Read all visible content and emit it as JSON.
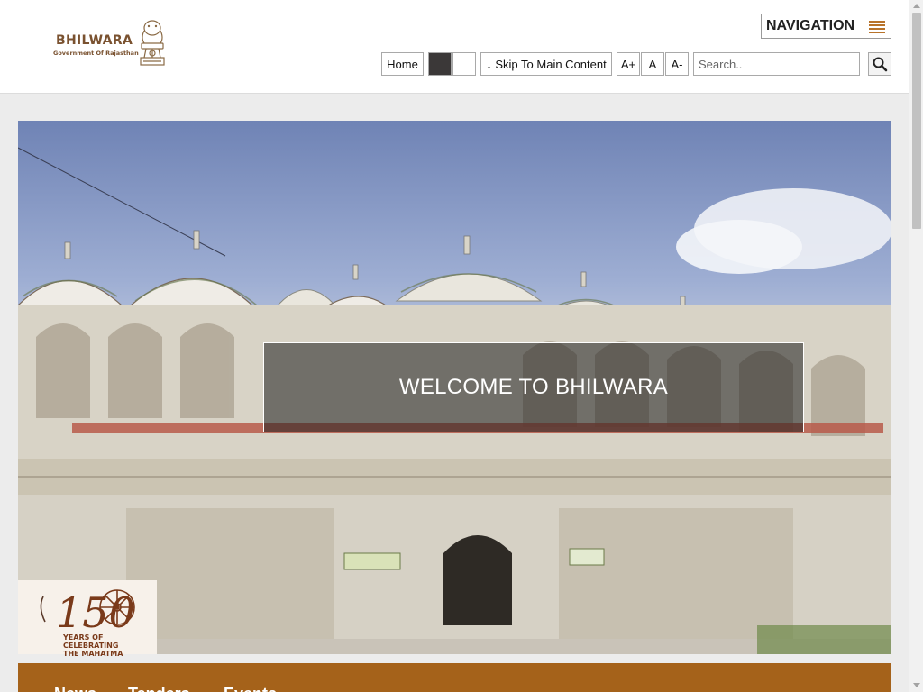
{
  "logo": {
    "title": "BHILWARA",
    "subtitle": "Government Of Rajasthan",
    "emblem_icon": "state-emblem-icon"
  },
  "navigation": {
    "label": "NAVIGATION",
    "icon": "hamburger-menu-icon"
  },
  "toolbar": {
    "home": "Home",
    "contrast_dark_color": "#3b3838",
    "contrast_light_color": "#ffffff",
    "skip": "↓ Skip To Main Content",
    "font_increase": "A+",
    "font_normal": "A",
    "font_decrease": "A-"
  },
  "search": {
    "placeholder": "Search..",
    "value": "",
    "button_icon": "search-icon"
  },
  "hero": {
    "welcome": "WELCOME TO BHILWARA"
  },
  "badge": {
    "number": "150",
    "line1": "YEARS OF",
    "line2": "CELEBRATING",
    "line3": "THE MAHATMA"
  },
  "footer_tabs": [
    {
      "label": "News"
    },
    {
      "label": "Tenders"
    },
    {
      "label": "Events"
    }
  ],
  "colors": {
    "brand_brown": "#7a5230",
    "accent_orange": "#a5621a",
    "menu_icon": "#b8732a"
  }
}
